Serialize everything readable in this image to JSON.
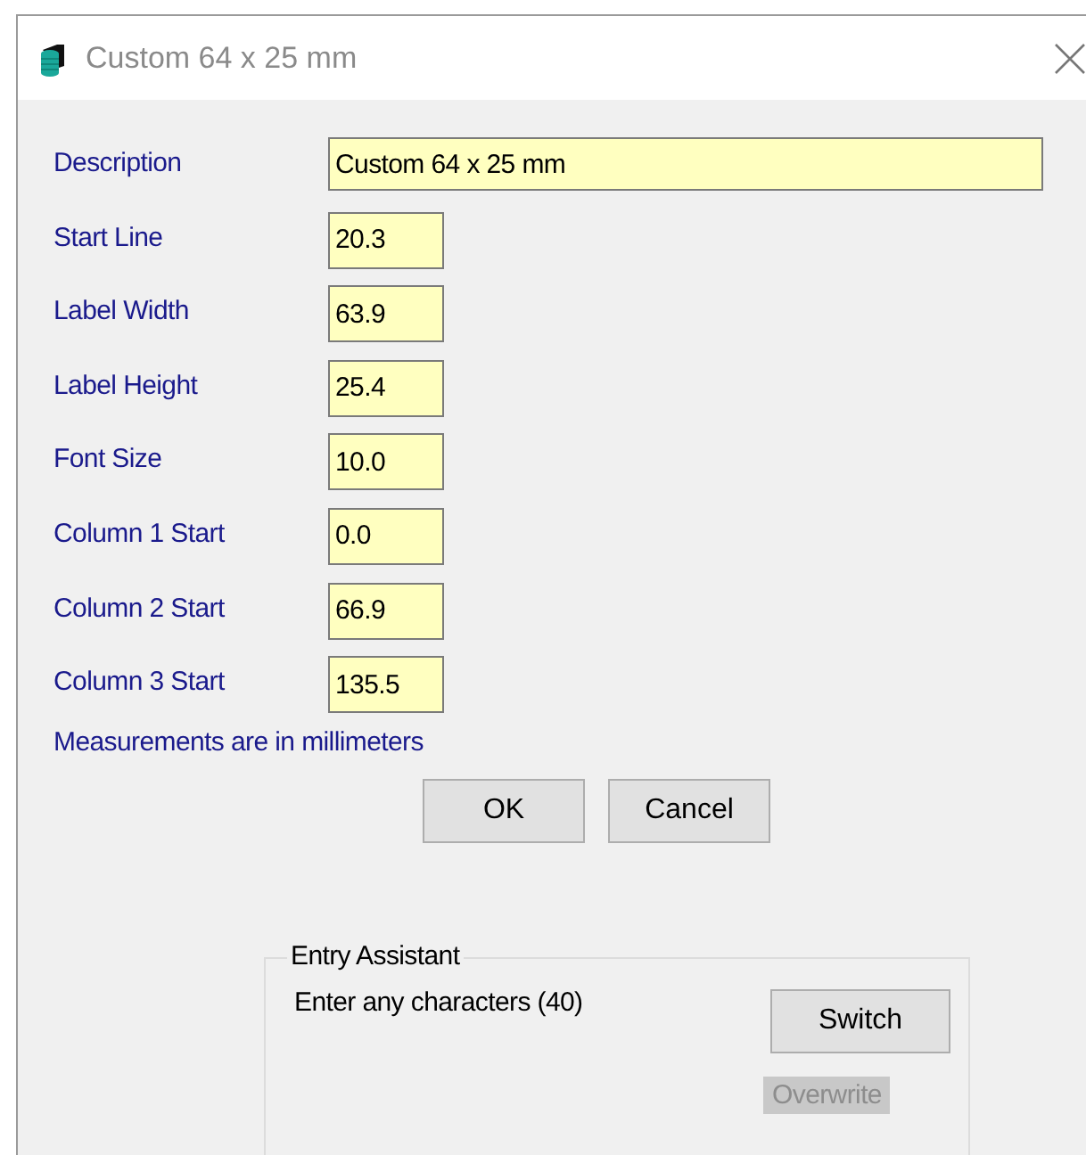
{
  "window": {
    "title": "Custom 64 x 25 mm"
  },
  "fields": [
    {
      "label": "Description",
      "value": "Custom 64 x 25 mm",
      "kind": "wide"
    },
    {
      "label": "Start Line",
      "value": "20.3",
      "kind": "short"
    },
    {
      "label": "Label Width",
      "value": "63.9",
      "kind": "short"
    },
    {
      "label": "Label Height",
      "value": "25.4",
      "kind": "short"
    },
    {
      "label": "Font Size",
      "value": "10.0",
      "kind": "short"
    },
    {
      "label": "Column 1 Start",
      "value": "0.0",
      "kind": "short"
    },
    {
      "label": "Column 2 Start",
      "value": "66.9",
      "kind": "short"
    },
    {
      "label": "Column 3 Start",
      "value": "135.5",
      "kind": "short"
    }
  ],
  "note": "Measurements are in millimeters",
  "buttons": [
    "OK",
    "Cancel"
  ],
  "entry_assistant": {
    "title": "Entry Assistant",
    "hint": "Enter any characters (40)",
    "switch_button": "Switch",
    "overwrite": {
      "label": "Overwrite",
      "disabled": true
    }
  }
}
